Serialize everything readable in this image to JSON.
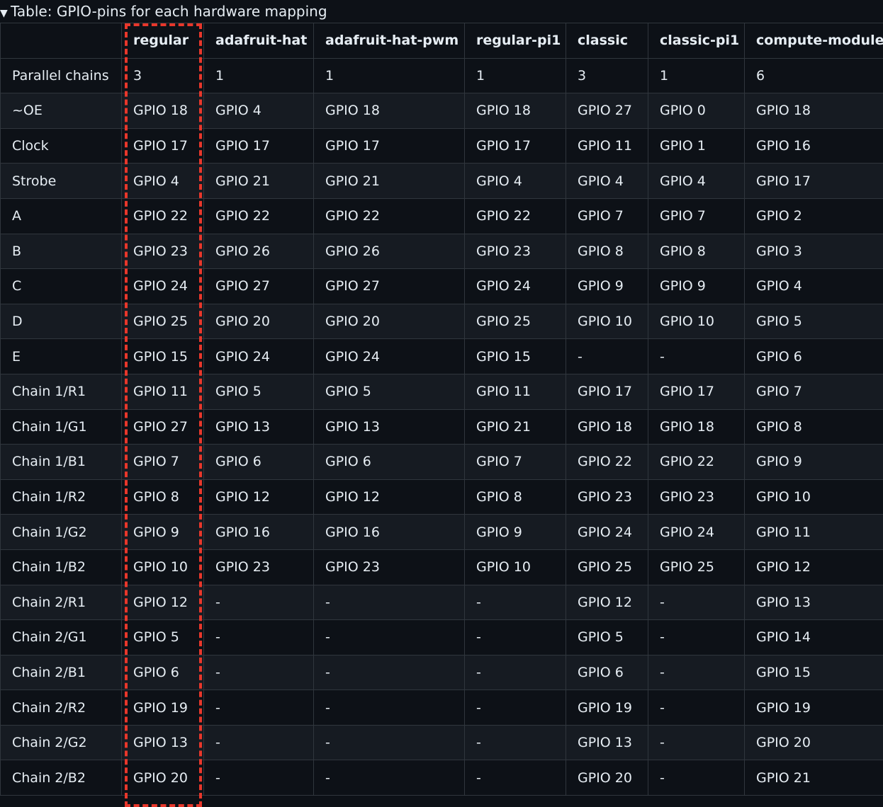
{
  "summary": {
    "triangle": "▼",
    "title": "Table: GPIO-pins for each hardware mapping"
  },
  "table": {
    "columns": [
      "",
      "regular",
      "adafruit-hat",
      "adafruit-hat-pwm",
      "regular-pi1",
      "classic",
      "classic-pi1",
      "compute-module"
    ],
    "rows": [
      [
        "Parallel chains",
        "3",
        "1",
        "1",
        "1",
        "3",
        "1",
        "6"
      ],
      [
        "~OE",
        "GPIO 18",
        "GPIO 4",
        "GPIO 18",
        "GPIO 18",
        "GPIO 27",
        "GPIO 0",
        "GPIO 18"
      ],
      [
        "Clock",
        "GPIO 17",
        "GPIO 17",
        "GPIO 17",
        "GPIO 17",
        "GPIO 11",
        "GPIO 1",
        "GPIO 16"
      ],
      [
        "Strobe",
        "GPIO 4",
        "GPIO 21",
        "GPIO 21",
        "GPIO 4",
        "GPIO 4",
        "GPIO 4",
        "GPIO 17"
      ],
      [
        "A",
        "GPIO 22",
        "GPIO 22",
        "GPIO 22",
        "GPIO 22",
        "GPIO 7",
        "GPIO 7",
        "GPIO 2"
      ],
      [
        "B",
        "GPIO 23",
        "GPIO 26",
        "GPIO 26",
        "GPIO 23",
        "GPIO 8",
        "GPIO 8",
        "GPIO 3"
      ],
      [
        "C",
        "GPIO 24",
        "GPIO 27",
        "GPIO 27",
        "GPIO 24",
        "GPIO 9",
        "GPIO 9",
        "GPIO 4"
      ],
      [
        "D",
        "GPIO 25",
        "GPIO 20",
        "GPIO 20",
        "GPIO 25",
        "GPIO 10",
        "GPIO 10",
        "GPIO 5"
      ],
      [
        "E",
        "GPIO 15",
        "GPIO 24",
        "GPIO 24",
        "GPIO 15",
        "-",
        "-",
        "GPIO 6"
      ],
      [
        "Chain 1/R1",
        "GPIO 11",
        "GPIO 5",
        "GPIO 5",
        "GPIO 11",
        "GPIO 17",
        "GPIO 17",
        "GPIO 7"
      ],
      [
        "Chain 1/G1",
        "GPIO 27",
        "GPIO 13",
        "GPIO 13",
        "GPIO 21",
        "GPIO 18",
        "GPIO 18",
        "GPIO 8"
      ],
      [
        "Chain 1/B1",
        "GPIO 7",
        "GPIO 6",
        "GPIO 6",
        "GPIO 7",
        "GPIO 22",
        "GPIO 22",
        "GPIO 9"
      ],
      [
        "Chain 1/R2",
        "GPIO 8",
        "GPIO 12",
        "GPIO 12",
        "GPIO 8",
        "GPIO 23",
        "GPIO 23",
        "GPIO 10"
      ],
      [
        "Chain 1/G2",
        "GPIO 9",
        "GPIO 16",
        "GPIO 16",
        "GPIO 9",
        "GPIO 24",
        "GPIO 24",
        "GPIO 11"
      ],
      [
        "Chain 1/B2",
        "GPIO 10",
        "GPIO 23",
        "GPIO 23",
        "GPIO 10",
        "GPIO 25",
        "GPIO 25",
        "GPIO 12"
      ],
      [
        "Chain 2/R1",
        "GPIO 12",
        "-",
        "-",
        "-",
        "GPIO 12",
        "-",
        "GPIO 13"
      ],
      [
        "Chain 2/G1",
        "GPIO 5",
        "-",
        "-",
        "-",
        "GPIO 5",
        "-",
        "GPIO 14"
      ],
      [
        "Chain 2/B1",
        "GPIO 6",
        "-",
        "-",
        "-",
        "GPIO 6",
        "-",
        "GPIO 15"
      ],
      [
        "Chain 2/R2",
        "GPIO 19",
        "-",
        "-",
        "-",
        "GPIO 19",
        "-",
        "GPIO 19"
      ],
      [
        "Chain 2/G2",
        "GPIO 13",
        "-",
        "-",
        "-",
        "GPIO 13",
        "-",
        "GPIO 20"
      ],
      [
        "Chain 2/B2",
        "GPIO 20",
        "-",
        "-",
        "-",
        "GPIO 20",
        "-",
        "GPIO 21"
      ]
    ]
  },
  "colors": {
    "background": "#0d1117",
    "row_alt": "#161b22",
    "border": "#30363d",
    "text": "#e6edf3",
    "highlight": "#e8372b"
  }
}
